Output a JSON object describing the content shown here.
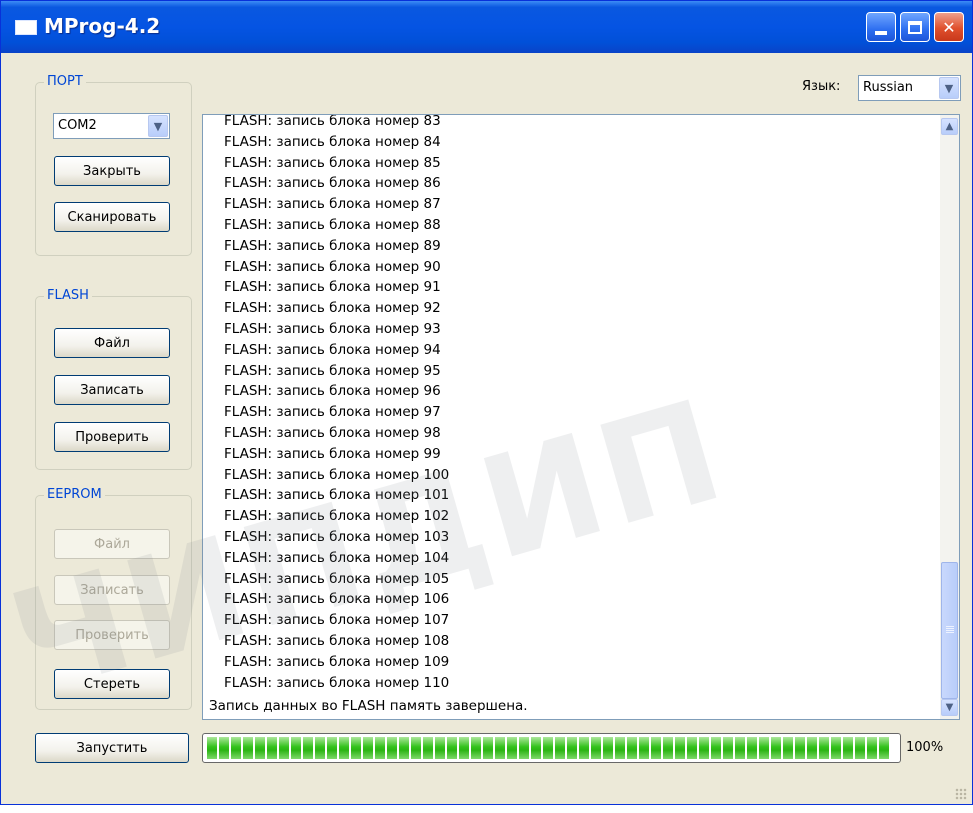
{
  "window": {
    "title": "MProg-4.2",
    "controls": {
      "minimize": "_",
      "maximize": "□",
      "close": "✕"
    }
  },
  "port": {
    "group_title": "ПОРТ",
    "selected": "COM2",
    "close_label": "Закрыть",
    "scan_label": "Сканировать"
  },
  "flash": {
    "group_title": "FLASH",
    "file_label": "Файл",
    "write_label": "Записать",
    "verify_label": "Проверить"
  },
  "eeprom": {
    "group_title": "EEPROM",
    "file_label": "Файл",
    "write_label": "Записать",
    "verify_label": "Проверить",
    "erase_label": "Стереть"
  },
  "run_label": "Запустить",
  "language": {
    "label": "Язык:",
    "selected": "Russian"
  },
  "log": {
    "lines": [
      "FLASH: запись блока номер 83",
      "FLASH: запись блока номер 84",
      "FLASH: запись блока номер 85",
      "FLASH: запись блока номер 86",
      "FLASH: запись блока номер 87",
      "FLASH: запись блока номер 88",
      "FLASH: запись блока номер 89",
      "FLASH: запись блока номер 90",
      "FLASH: запись блока номер 91",
      "FLASH: запись блока номер 92",
      "FLASH: запись блока номер 93",
      "FLASH: запись блока номер 94",
      "FLASH: запись блока номер 95",
      "FLASH: запись блока номер 96",
      "FLASH: запись блока номер 97",
      "FLASH: запись блока номер 98",
      "FLASH: запись блока номер 99",
      "FLASH: запись блока номер 100",
      "FLASH: запись блока номер 101",
      "FLASH: запись блока номер 102",
      "FLASH: запись блока номер 103",
      "FLASH: запись блока номер 104",
      "FLASH: запись блока номер 105",
      "FLASH: запись блока номер 106",
      "FLASH: запись блока номер 107",
      "FLASH: запись блока номер 108",
      "FLASH: запись блока номер 109",
      "FLASH: запись блока номер 110"
    ],
    "final_line": "Запись данных во FLASH память завершена."
  },
  "progress": {
    "value_fraction": 1.0,
    "text": "100%"
  },
  "colors": {
    "title_bar": "#0554e3",
    "group_title": "#0046d5",
    "progress_fill": "#33c21c"
  },
  "icons": [
    "window-icon",
    "minimize-icon",
    "maximize-icon",
    "close-icon",
    "dropdown-arrow-icon",
    "scroll-up-icon",
    "scroll-down-icon",
    "resize-grip-icon"
  ]
}
